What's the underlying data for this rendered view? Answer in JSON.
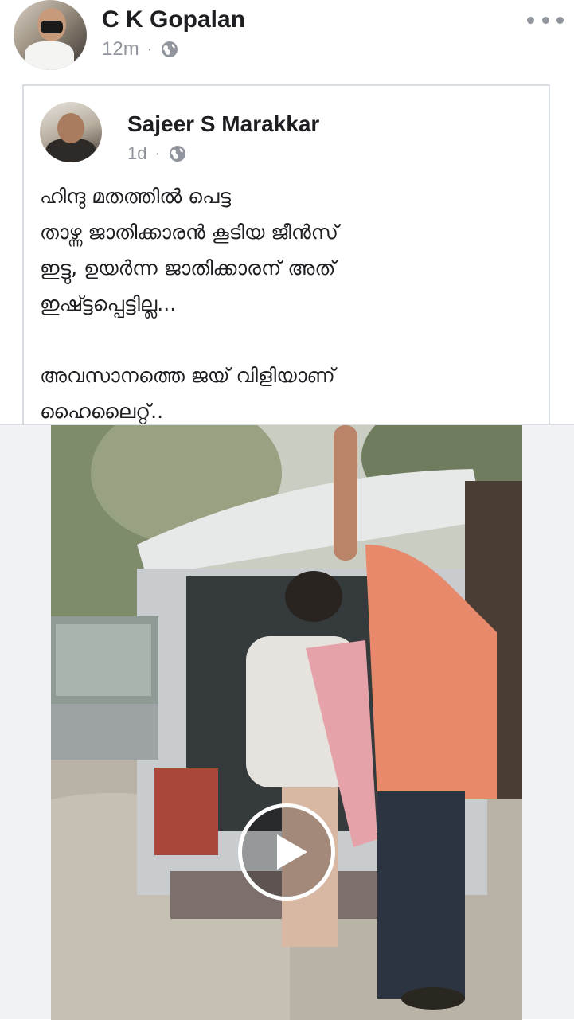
{
  "outer_post": {
    "author": "C K Gopalan",
    "time": "12m",
    "separator": "·",
    "privacy_icon": "globe-icon",
    "more_icon": "more-dots-icon"
  },
  "shared_post": {
    "author": "Sajeer S Marakkar",
    "time": "1d",
    "separator": "·",
    "privacy_icon": "globe-icon",
    "text_lines": [
      "ഹിന്ദു മതത്തിൽ പെട്ട",
      "താഴ്ന്ന ജാതിക്കാരൻ കൂടിയ ജീൻസ്",
      "ഇട്ടു, ഉയർന്ന ജാതിക്കാരന് അത്",
      "ഇഷ്ട്ടപ്പെട്ടില്ല...",
      "അവസാനത്തെ ജയ് വിളിയാണ്",
      "ഹൈലൈറ്റ്.."
    ]
  },
  "video": {
    "play_icon": "play-icon"
  },
  "colors": {
    "text_primary": "#1c1e21",
    "text_secondary": "#90949c",
    "card_border": "#d8dce3",
    "video_backdrop": "#f0f2f5"
  }
}
